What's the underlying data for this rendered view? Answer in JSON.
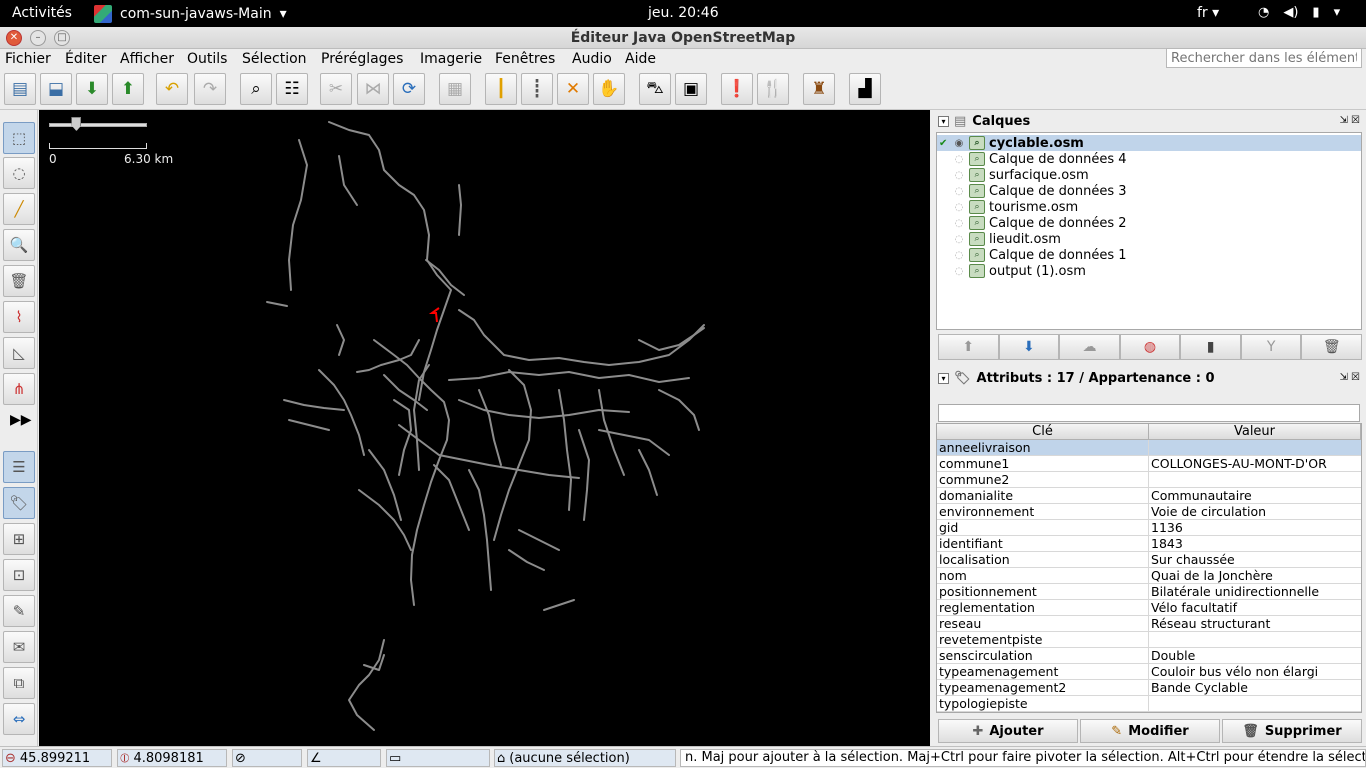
{
  "system_bar": {
    "activities": "Activités",
    "app_name": "com-sun-javaws-Main",
    "clock": "jeu. 20:46",
    "lang": "fr"
  },
  "window": {
    "title": "Éditeur Java OpenStreetMap"
  },
  "menu": [
    "Fichier",
    "Éditer",
    "Afficher",
    "Outils",
    "Sélection",
    "Préréglages",
    "Imagerie",
    "Fenêtres",
    "Audio",
    "Aide"
  ],
  "search": {
    "placeholder": "Rechercher dans les éléments"
  },
  "map": {
    "scale_start": "0",
    "scale_end": "6.30 km",
    "zoom_slider": 0.28
  },
  "layers_panel": {
    "title": "Calques",
    "layers": [
      {
        "name": "cyclable.osm",
        "active": true
      },
      {
        "name": "Calque de données 4",
        "active": false
      },
      {
        "name": "surfacique.osm",
        "active": false
      },
      {
        "name": "Calque de données 3",
        "active": false
      },
      {
        "name": "tourisme.osm",
        "active": false
      },
      {
        "name": "Calque de données 2",
        "active": false
      },
      {
        "name": "lieudit.osm",
        "active": false
      },
      {
        "name": "Calque de données 1",
        "active": false
      },
      {
        "name": "output (1).osm",
        "active": false
      }
    ]
  },
  "attributes_panel": {
    "title": "Attributs : 17 / Appartenance : 0",
    "col_key": "Clé",
    "col_value": "Valeur",
    "rows": [
      {
        "k": "anneelivraison",
        "v": ""
      },
      {
        "k": "commune1",
        "v": "COLLONGES-AU-MONT-D'OR"
      },
      {
        "k": "commune2",
        "v": ""
      },
      {
        "k": "domanialite",
        "v": "Communautaire"
      },
      {
        "k": "environnement",
        "v": "Voie de circulation"
      },
      {
        "k": "gid",
        "v": "1136"
      },
      {
        "k": "identifiant",
        "v": "1843"
      },
      {
        "k": "localisation",
        "v": "Sur chaussée"
      },
      {
        "k": "nom",
        "v": "Quai de la Jonchère"
      },
      {
        "k": "positionnement",
        "v": "Bilatérale unidirectionnelle"
      },
      {
        "k": "reglementation",
        "v": "Vélo facultatif"
      },
      {
        "k": "reseau",
        "v": "Réseau structurant"
      },
      {
        "k": "revetementpiste",
        "v": ""
      },
      {
        "k": "senscirculation",
        "v": "Double"
      },
      {
        "k": "typeamenagement",
        "v": "Couloir bus vélo non élargi"
      },
      {
        "k": "typeamenagement2",
        "v": "Bande Cyclable"
      },
      {
        "k": "typologiepiste",
        "v": ""
      }
    ],
    "add_label": "Ajouter",
    "edit_label": "Modifier",
    "delete_label": "Supprimer"
  },
  "status": {
    "lat": "45.899211",
    "lon": "4.8098181",
    "selection": "(aucune sélection)",
    "help": "n. Maj pour ajouter à la sélection. Maj+Ctrl pour faire pivoter la sélection. Alt+Ctrl pour étendre la sélection."
  },
  "colors": {
    "map_bg": "#000000",
    "road": "#8c8c8c",
    "selected_way": "#ff0000",
    "selection_bg": "#c0d4ea"
  }
}
